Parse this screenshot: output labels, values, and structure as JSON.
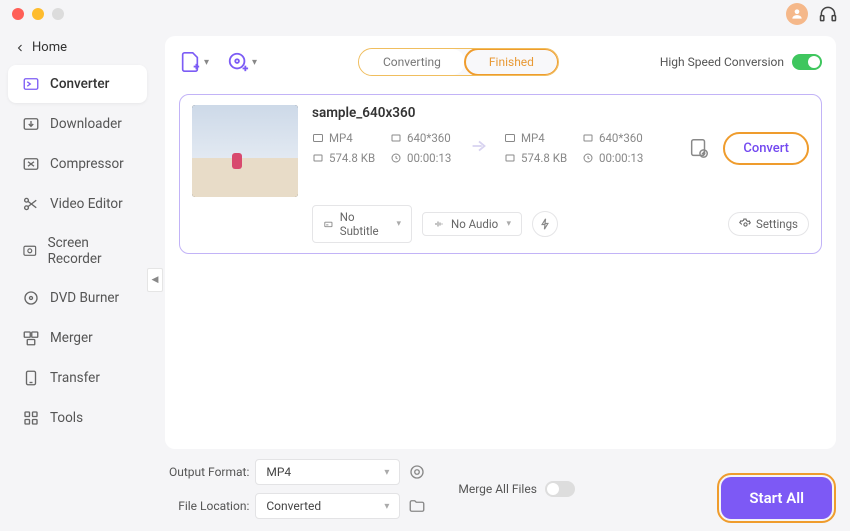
{
  "sidebar": {
    "home": "Home",
    "items": [
      {
        "label": "Converter",
        "icon": "convert"
      },
      {
        "label": "Downloader",
        "icon": "download"
      },
      {
        "label": "Compressor",
        "icon": "compress"
      },
      {
        "label": "Video Editor",
        "icon": "edit"
      },
      {
        "label": "Screen Recorder",
        "icon": "record"
      },
      {
        "label": "DVD Burner",
        "icon": "disc"
      },
      {
        "label": "Merger",
        "icon": "merge"
      },
      {
        "label": "Transfer",
        "icon": "transfer"
      },
      {
        "label": "Tools",
        "icon": "tools"
      }
    ]
  },
  "tabs": {
    "converting": "Converting",
    "finished": "Finished"
  },
  "toolbar": {
    "high_speed_label": "High Speed Conversion"
  },
  "file": {
    "name": "sample_640x360",
    "source": {
      "format": "MP4",
      "resolution": "640*360",
      "size": "574.8 KB",
      "duration": "00:00:13"
    },
    "target": {
      "format": "MP4",
      "resolution": "640*360",
      "size": "574.8 KB",
      "duration": "00:00:13"
    },
    "subtitle": "No Subtitle",
    "audio": "No Audio",
    "settings_label": "Settings",
    "convert_label": "Convert"
  },
  "bottom": {
    "output_format_label": "Output Format:",
    "output_format_value": "MP4",
    "file_location_label": "File Location:",
    "file_location_value": "Converted",
    "merge_label": "Merge All Files",
    "start_all_label": "Start All"
  }
}
